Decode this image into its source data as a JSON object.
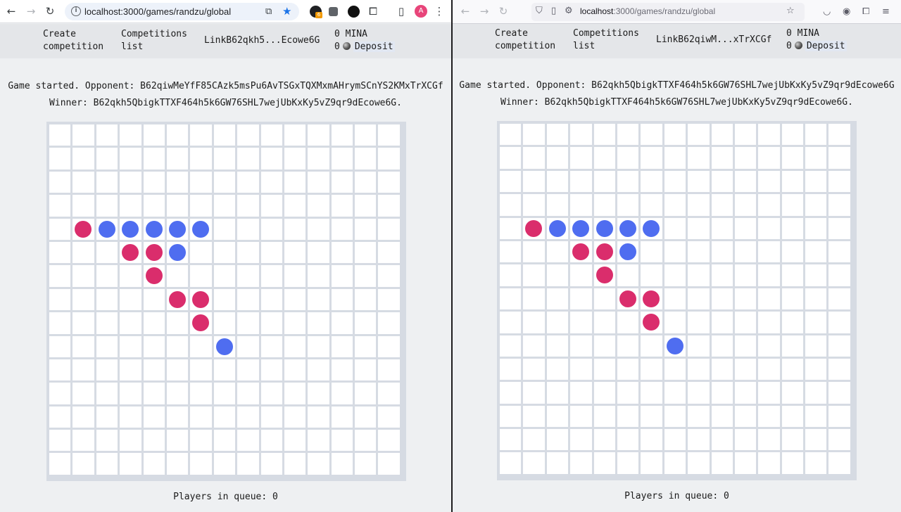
{
  "left_window": {
    "browser": "chrome",
    "url": "localhost:3000/games/randzu/global",
    "extension_badge": "6",
    "profile_initial": "A",
    "header": {
      "create_line1": "Create",
      "create_line2": "competition",
      "list_line1": "Competitions",
      "list_line2": "list",
      "account": "LinkB62qkh5...Ecowe6G",
      "balance": "0 MINA",
      "deposit_amount": "0",
      "deposit_label": "Deposit"
    },
    "game": {
      "status": "Game started. Opponent: B62qiwMeYfF85CAzk5msPu6AvTSGxTQXMxmAHrymSCnYS2KMxTrXCGf",
      "winner": "Winner: B62qkh5QbigkTTXF464h5k6GW76SHL7wejUbKxKy5vZ9qr9dEcowe6G."
    },
    "queue": "Players in queue: 0"
  },
  "right_window": {
    "browser": "firefox",
    "url_host": "localhost",
    "url_rest": ":3000/games/randzu/global",
    "header": {
      "create_line1": "Create",
      "create_line2": "competition",
      "list_line1": "Competitions",
      "list_line2": "list",
      "account": "LinkB62qiwM...xTrXCGf",
      "balance": "0 MINA",
      "deposit_amount": "0",
      "deposit_label": "Deposit"
    },
    "game": {
      "status": "Game started. Opponent: B62qkh5QbigkTTXF464h5k6GW76SHL7wejUbKxKy5vZ9qr9dEcowe6G",
      "winner": "Winner: B62qkh5QbigkTTXF464h5k6GW76SHL7wejUbKxKy5vZ9qr9dEcowe6G."
    },
    "queue": "Players in queue: 0"
  },
  "board": {
    "size": 15,
    "colors": {
      "red": "#da2d6c",
      "blue": "#4f6df0",
      "grid": "#d6dbe3"
    },
    "stones": [
      {
        "row": 4,
        "col": 1,
        "color": "red"
      },
      {
        "row": 4,
        "col": 2,
        "color": "blue"
      },
      {
        "row": 4,
        "col": 3,
        "color": "blue"
      },
      {
        "row": 4,
        "col": 4,
        "color": "blue"
      },
      {
        "row": 4,
        "col": 5,
        "color": "blue"
      },
      {
        "row": 4,
        "col": 6,
        "color": "blue"
      },
      {
        "row": 5,
        "col": 3,
        "color": "red"
      },
      {
        "row": 5,
        "col": 4,
        "color": "red"
      },
      {
        "row": 5,
        "col": 5,
        "color": "blue"
      },
      {
        "row": 6,
        "col": 4,
        "color": "red"
      },
      {
        "row": 7,
        "col": 5,
        "color": "red"
      },
      {
        "row": 7,
        "col": 6,
        "color": "red"
      },
      {
        "row": 8,
        "col": 6,
        "color": "red"
      },
      {
        "row": 9,
        "col": 7,
        "color": "blue"
      }
    ]
  }
}
